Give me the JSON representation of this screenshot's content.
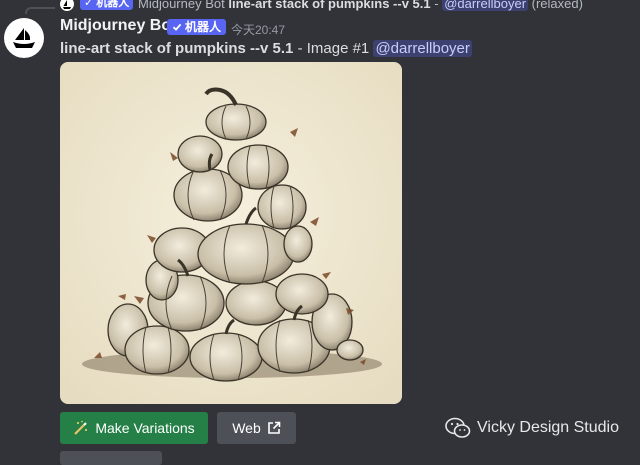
{
  "reply": {
    "bot_tag": "✓ 机器人",
    "author": "Midjourney Bot",
    "prompt": "line-art stack of pumpkins --v 5.1",
    "separator": " - ",
    "mention": "@darrellboyer",
    "suffix": " (relaxed)"
  },
  "message": {
    "author": "Midjourney Bot",
    "bot_tag": "机器人",
    "timestamp": "今天20:47",
    "prompt": "line-art stack of pumpkins --v 5.1",
    "image_label": " - Image #1 ",
    "mention": "@darrellboyer"
  },
  "buttons": {
    "variations_label": "Make Variations",
    "web_label": "Web"
  },
  "watermark": {
    "text": "Vicky Design Studio"
  },
  "icons": [
    "midjourney-boat-icon",
    "check-icon",
    "magic-wand-icon",
    "external-link-icon",
    "wechat-icon"
  ],
  "colors": {
    "background": "#313338",
    "bot_tag": "#5865f2",
    "green_button": "#248046",
    "grey_button": "#4e5058"
  }
}
